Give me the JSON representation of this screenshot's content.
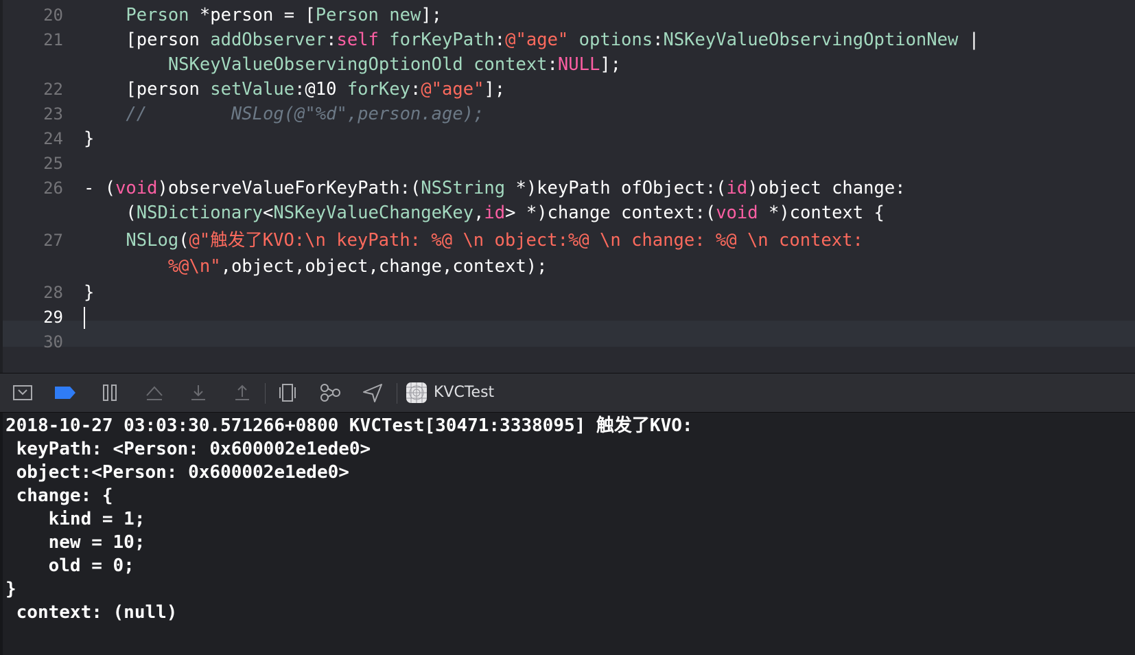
{
  "editor": {
    "line_numbers": [
      "20",
      "21",
      "22",
      "23",
      "24",
      "25",
      "26",
      "27",
      "28",
      "29",
      "30"
    ],
    "lines": [
      {
        "text_parts": [
          {
            "t": "    ",
            "c": "plain"
          },
          {
            "t": "Person",
            "c": "type"
          },
          {
            "t": " *person = [",
            "c": "plain"
          },
          {
            "t": "Person",
            "c": "type"
          },
          {
            "t": " ",
            "c": "plain"
          },
          {
            "t": "new",
            "c": "method"
          },
          {
            "t": "];",
            "c": "plain"
          }
        ]
      },
      {
        "text_parts": [
          {
            "t": "    [person ",
            "c": "plain"
          },
          {
            "t": "addObserver",
            "c": "method"
          },
          {
            "t": ":",
            "c": "plain"
          },
          {
            "t": "self",
            "c": "keyword"
          },
          {
            "t": " ",
            "c": "plain"
          },
          {
            "t": "forKeyPath",
            "c": "method"
          },
          {
            "t": ":",
            "c": "plain"
          },
          {
            "t": "@\"age\"",
            "c": "string"
          },
          {
            "t": " ",
            "c": "plain"
          },
          {
            "t": "options",
            "c": "method"
          },
          {
            "t": ":",
            "c": "plain"
          },
          {
            "t": "NSKeyValueObservingOptionNew",
            "c": "type"
          },
          {
            "t": " |",
            "c": "plain"
          }
        ]
      },
      {
        "text_parts": [
          {
            "t": "        ",
            "c": "plain"
          },
          {
            "t": "NSKeyValueObservingOptionOld",
            "c": "type"
          },
          {
            "t": " ",
            "c": "plain"
          },
          {
            "t": "context",
            "c": "method"
          },
          {
            "t": ":",
            "c": "plain"
          },
          {
            "t": "NULL",
            "c": "keyword"
          },
          {
            "t": "];",
            "c": "plain"
          }
        ]
      },
      {
        "text_parts": [
          {
            "t": "    [person ",
            "c": "plain"
          },
          {
            "t": "setValue",
            "c": "method"
          },
          {
            "t": ":@10 ",
            "c": "plain"
          },
          {
            "t": "forKey",
            "c": "method"
          },
          {
            "t": ":",
            "c": "plain"
          },
          {
            "t": "@\"age\"",
            "c": "string"
          },
          {
            "t": "];",
            "c": "plain"
          }
        ]
      },
      {
        "text_parts": [
          {
            "t": "    //        NSLog(@\"%d\",person.age);",
            "c": "comment"
          }
        ]
      },
      {
        "text_parts": [
          {
            "t": "}",
            "c": "plain"
          }
        ]
      },
      {
        "text_parts": [
          {
            "t": "",
            "c": "plain"
          }
        ]
      },
      {
        "text_parts": [
          {
            "t": "- (",
            "c": "plain"
          },
          {
            "t": "void",
            "c": "keyword"
          },
          {
            "t": ")observeValueForKeyPath:(",
            "c": "plain"
          },
          {
            "t": "NSString",
            "c": "type"
          },
          {
            "t": " *)keyPath ofObject:(",
            "c": "plain"
          },
          {
            "t": "id",
            "c": "keyword"
          },
          {
            "t": ")object change:",
            "c": "plain"
          }
        ]
      },
      {
        "text_parts": [
          {
            "t": "    (",
            "c": "plain"
          },
          {
            "t": "NSDictionary",
            "c": "type"
          },
          {
            "t": "<",
            "c": "plain"
          },
          {
            "t": "NSKeyValueChangeKey",
            "c": "type"
          },
          {
            "t": ",",
            "c": "plain"
          },
          {
            "t": "id",
            "c": "keyword"
          },
          {
            "t": "> *)change context:(",
            "c": "plain"
          },
          {
            "t": "void",
            "c": "keyword"
          },
          {
            "t": " *)context {",
            "c": "plain"
          }
        ]
      },
      {
        "text_parts": [
          {
            "t": "    ",
            "c": "plain"
          },
          {
            "t": "NSLog",
            "c": "method"
          },
          {
            "t": "(",
            "c": "plain"
          },
          {
            "t": "@\"触发了KVO:\\n keyPath: %@ \\n object:%@ \\n change: %@ \\n context:",
            "c": "string"
          }
        ]
      },
      {
        "text_parts": [
          {
            "t": "        ",
            "c": "plain"
          },
          {
            "t": "%@\\n\"",
            "c": "string"
          },
          {
            "t": ",object,object,change,context);",
            "c": "plain"
          }
        ]
      },
      {
        "text_parts": [
          {
            "t": "}",
            "c": "plain"
          }
        ]
      },
      {
        "text_parts": [
          {
            "t": "",
            "c": "plain"
          }
        ]
      },
      {
        "text_parts": [
          {
            "t": "",
            "c": "plain"
          }
        ]
      }
    ]
  },
  "colors": {
    "plain": "#ffffff",
    "type": "#a3d9bf",
    "type_alt": "#d0a8ff",
    "method": "#a3d9bf",
    "keyword": "#fc5fa3",
    "string": "#fc6a5d",
    "comment": "#6c7986",
    "editor_bg": "#292a30",
    "console_bg": "#1f2024",
    "breakpoint_blue": "#2f7cf6"
  },
  "debug_bar": {
    "target_label": "KVCTest",
    "icons": [
      "hide-debug-area-icon",
      "breakpoints-toggle-icon",
      "pause-continue-icon",
      "step-over-icon",
      "step-into-icon",
      "step-out-icon",
      "debug-view-hierarchy-icon",
      "debug-memory-graph-icon",
      "simulate-location-icon",
      "app-target-icon"
    ]
  },
  "console": {
    "lines": [
      "2018-10-27 03:03:30.571266+0800 KVCTest[30471:3338095] 触发了KVO:",
      " keyPath: <Person: 0x600002e1ede0>",
      " object:<Person: 0x600002e1ede0>",
      " change: {",
      "    kind = 1;",
      "    new = 10;",
      "    old = 0;",
      "}",
      " context: (null)"
    ]
  }
}
